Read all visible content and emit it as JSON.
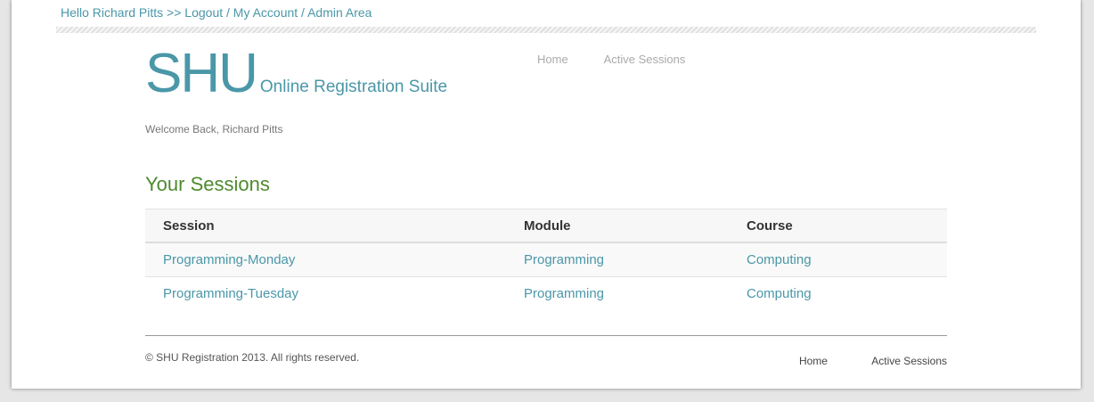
{
  "topbar": {
    "greeting": "Hello Richard Pitts",
    "sep1": " >> ",
    "logout": "Logout",
    "sep2": " / ",
    "my_account": "My Account",
    "sep3": " / ",
    "admin_area": "Admin Area"
  },
  "logo": {
    "big": "SHU",
    "small": "Online Registration Suite"
  },
  "nav": {
    "items": [
      {
        "label": "Home"
      },
      {
        "label": "Active Sessions"
      }
    ]
  },
  "welcome": "Welcome Back, Richard Pitts",
  "sessions": {
    "heading": "Your Sessions",
    "columns": [
      "Session",
      "Module",
      "Course"
    ],
    "rows": [
      {
        "session": "Programming-Monday",
        "module": "Programming",
        "course": "Computing"
      },
      {
        "session": "Programming-Tuesday",
        "module": "Programming",
        "course": "Computing"
      }
    ]
  },
  "footer": {
    "copyright": "© SHU Registration 2013. All rights reserved.",
    "links": [
      {
        "label": "Home"
      },
      {
        "label": "Active Sessions"
      }
    ]
  },
  "colors": {
    "accent": "#4a97a8",
    "heading": "#4e8a2e"
  }
}
